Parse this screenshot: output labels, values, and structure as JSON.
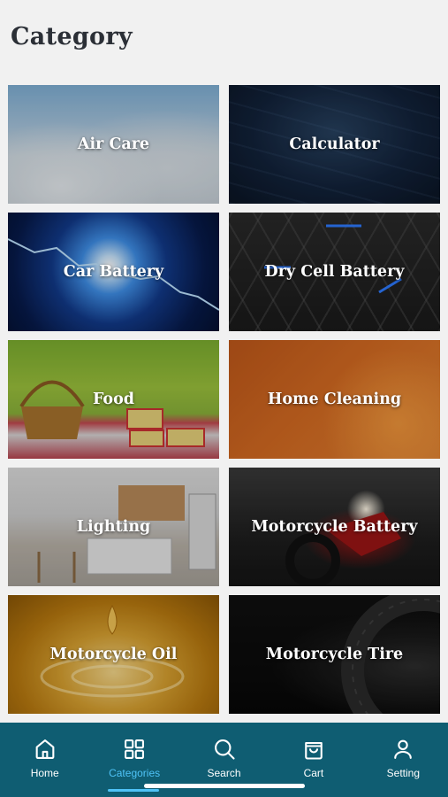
{
  "page": {
    "title": "Category"
  },
  "categories": [
    {
      "label": "Air Care"
    },
    {
      "label": "Calculator"
    },
    {
      "label": "Car Battery"
    },
    {
      "label": "Dry Cell Battery"
    },
    {
      "label": "Food"
    },
    {
      "label": "Home Cleaning"
    },
    {
      "label": "Lighting"
    },
    {
      "label": "Motorcycle Battery"
    },
    {
      "label": "Motorcycle Oil"
    },
    {
      "label": "Motorcycle Tire"
    }
  ],
  "nav": {
    "items": [
      {
        "label": "Home",
        "icon": "home-icon"
      },
      {
        "label": "Categories",
        "icon": "grid-icon",
        "active": true
      },
      {
        "label": "Search",
        "icon": "search-icon"
      },
      {
        "label": "Cart",
        "icon": "bag-icon"
      },
      {
        "label": "Setting",
        "icon": "person-icon"
      }
    ]
  },
  "colors": {
    "nav_background": "#0f5d72",
    "nav_active": "#4fc3f7",
    "page_background": "#f1f1f1"
  }
}
